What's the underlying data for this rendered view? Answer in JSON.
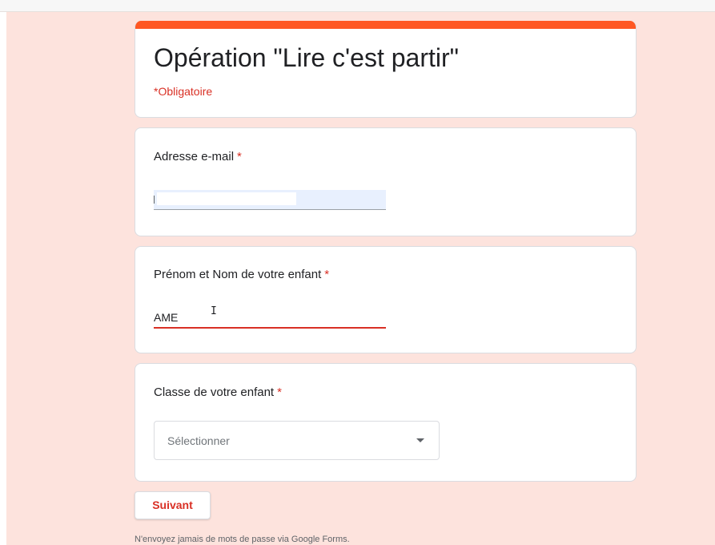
{
  "form": {
    "title": "Opération \"Lire c'est partir\"",
    "required_note": "*Obligatoire"
  },
  "questions": {
    "email": {
      "label": "Adresse e-mail",
      "required_mark": "*",
      "value": ""
    },
    "child_name": {
      "label": "Prénom et Nom de votre enfant",
      "required_mark": "*",
      "value": "AME"
    },
    "child_class": {
      "label": "Classe de votre enfant",
      "required_mark": "*",
      "selected": "Sélectionner"
    }
  },
  "actions": {
    "next_label": "Suivant"
  },
  "footer": {
    "note": "N'envoyez jamais de mots de passe via Google Forms."
  },
  "colors": {
    "accent": "#ff5722",
    "background": "#fde3dd",
    "required": "#d93025",
    "autofill": "#e8f0fe"
  }
}
